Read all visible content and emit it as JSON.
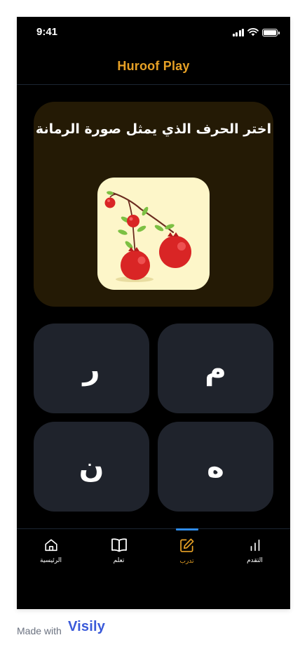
{
  "status_bar": {
    "time": "9:41",
    "icons": [
      "cellular-signal-icon",
      "wifi-icon",
      "battery-icon"
    ]
  },
  "header": {
    "title": "Huroof Play",
    "title_color": "#e7a126"
  },
  "question": {
    "prompt": "اختر الحرف الذي يمثل صورة الرمانة",
    "image": "pomegranate-illustration"
  },
  "options": [
    {
      "letter": "م"
    },
    {
      "letter": "ر"
    },
    {
      "letter": "ه"
    },
    {
      "letter": "ن"
    }
  ],
  "bottom_nav": {
    "items": [
      {
        "label": "الرئيسية",
        "icon": "home-icon",
        "active": false
      },
      {
        "label": "تعلم",
        "icon": "book-icon",
        "active": false
      },
      {
        "label": "تدرب",
        "icon": "edit-icon",
        "active": true
      },
      {
        "label": "التقدم",
        "icon": "bar-chart-icon",
        "active": false
      }
    ],
    "active_color": "#e7a126",
    "indicator_color": "#2f8be8"
  },
  "footer": {
    "made_with": "Made with",
    "brand": "Visily",
    "brand_color": "#3a5ad9"
  },
  "colors": {
    "background": "#000000",
    "card": "#241a05",
    "option_bg": "#1f232c"
  }
}
